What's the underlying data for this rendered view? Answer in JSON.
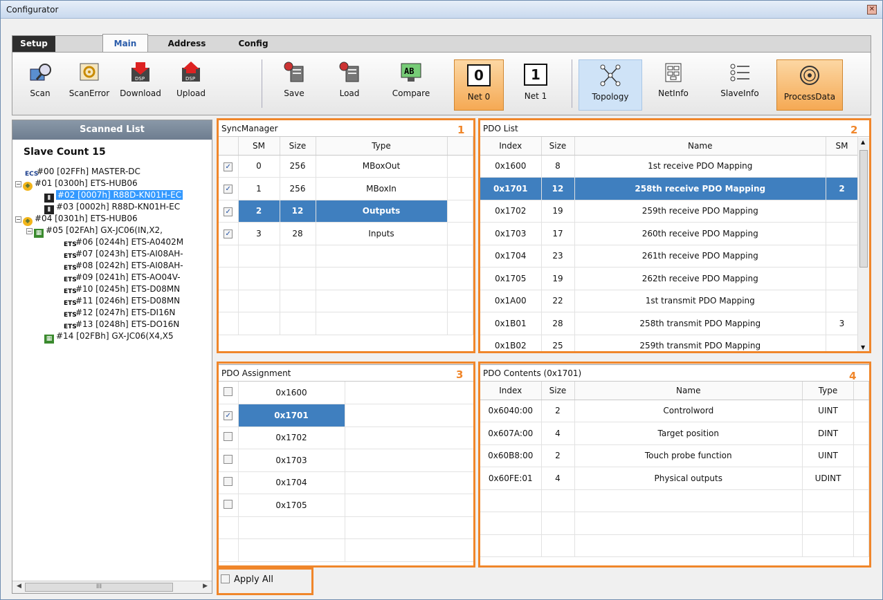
{
  "window": {
    "title": "Configurator"
  },
  "tabs": [
    {
      "label": "Setup"
    },
    {
      "label": "Main"
    },
    {
      "label": "Address"
    },
    {
      "label": "Config"
    }
  ],
  "toolbar": {
    "scan": "Scan",
    "scan_error": "ScanError",
    "download": "Download",
    "upload": "Upload",
    "save": "Save",
    "load": "Load",
    "compare": "Compare",
    "net0_number": "0",
    "net0": "Net 0",
    "net1_number": "1",
    "net1": "Net 1",
    "topology": "Topology",
    "netinfo": "NetInfo",
    "slaveinfo": "SlaveInfo",
    "processdata": "ProcessData",
    "dsp": "DSP",
    "compare_glyph": "AB"
  },
  "scanned_list": {
    "header": "Scanned List",
    "slave_count": "Slave Count  15",
    "tree": [
      {
        "text": "#00  [02FFh] MASTER-DC",
        "icon": "ECS"
      },
      {
        "text": "#01  [0300h] ETS-HUB06",
        "icon": "hub"
      },
      {
        "text": "#02  [0007h] R88D-KN01H-EC",
        "icon": "dev"
      },
      {
        "text": "#03  [0002h] R88D-KN01H-EC",
        "icon": "dev"
      },
      {
        "text": "#04  [0301h] ETS-HUB06",
        "icon": "hub"
      },
      {
        "text": "#05  [02FAh] GX-JC06(IN,X2,",
        "icon": "gx"
      },
      {
        "text": "#06  [0244h] ETS-A0402M",
        "icon": "ETS"
      },
      {
        "text": "#07  [0243h] ETS-AI08AH-",
        "icon": "ETS"
      },
      {
        "text": "#08  [0242h] ETS-AI08AH-",
        "icon": "ETS"
      },
      {
        "text": "#09  [0241h] ETS-AO04V-",
        "icon": "ETS"
      },
      {
        "text": "#10  [0245h] ETS-D08MN",
        "icon": "ETS"
      },
      {
        "text": "#11  [0246h] ETS-D08MN",
        "icon": "ETS"
      },
      {
        "text": "#12  [0247h] ETS-DI16N",
        "icon": "ETS"
      },
      {
        "text": "#13  [0248h] ETS-DO16N",
        "icon": "ETS"
      },
      {
        "text": "#14  [02FBh] GX-JC06(X4,X5",
        "icon": "gx"
      }
    ],
    "scroll_thumb": "III"
  },
  "sync_manager": {
    "title": "SyncManager",
    "marker": "1",
    "columns": [
      "SM",
      "Size",
      "Type"
    ],
    "rows": [
      {
        "checked": "✓",
        "sm": "0",
        "size": "256",
        "type": "MBoxOut"
      },
      {
        "checked": "✓",
        "sm": "1",
        "size": "256",
        "type": "MBoxIn"
      },
      {
        "checked": "✓",
        "sm": "2",
        "size": "12",
        "type": "Outputs"
      },
      {
        "checked": "✓",
        "sm": "3",
        "size": "28",
        "type": "Inputs"
      }
    ]
  },
  "pdo_list": {
    "title": "PDO List",
    "marker": "2",
    "columns": [
      "Index",
      "Size",
      "Name",
      "SM"
    ],
    "rows": [
      {
        "index": "0x1600",
        "size": "8",
        "name": "1st receive PDO Mapping",
        "sm": ""
      },
      {
        "index": "0x1701",
        "size": "12",
        "name": "258th receive PDO Mapping",
        "sm": "2"
      },
      {
        "index": "0x1702",
        "size": "19",
        "name": "259th receive PDO Mapping",
        "sm": ""
      },
      {
        "index": "0x1703",
        "size": "17",
        "name": "260th receive PDO Mapping",
        "sm": ""
      },
      {
        "index": "0x1704",
        "size": "23",
        "name": "261th receive PDO Mapping",
        "sm": ""
      },
      {
        "index": "0x1705",
        "size": "19",
        "name": "262th receive PDO Mapping",
        "sm": ""
      },
      {
        "index": "0x1A00",
        "size": "22",
        "name": "1st transmit PDO Mapping",
        "sm": ""
      },
      {
        "index": "0x1B01",
        "size": "28",
        "name": "258th transmit PDO Mapping",
        "sm": "3"
      },
      {
        "index": "0x1B02",
        "size": "25",
        "name": "259th transmit PDO Mapping",
        "sm": ""
      }
    ]
  },
  "pdo_assignment": {
    "title": "PDO Assignment",
    "marker": "3",
    "rows": [
      {
        "checked": "",
        "index": "0x1600"
      },
      {
        "checked": "✓",
        "index": "0x1701"
      },
      {
        "checked": "",
        "index": "0x1702"
      },
      {
        "checked": "",
        "index": "0x1703"
      },
      {
        "checked": "",
        "index": "0x1704"
      },
      {
        "checked": "",
        "index": "0x1705"
      }
    ]
  },
  "pdo_contents": {
    "title": "PDO Contents (0x1701)",
    "marker": "4",
    "columns": [
      "Index",
      "Size",
      "Name",
      "Type"
    ],
    "rows": [
      {
        "index": "0x6040:00",
        "size": "2",
        "name": "Controlword",
        "type": "UINT"
      },
      {
        "index": "0x607A:00",
        "size": "4",
        "name": "Target position",
        "type": "DINT"
      },
      {
        "index": "0x60B8:00",
        "size": "2",
        "name": "Touch probe function",
        "type": "UINT"
      },
      {
        "index": "0x60FE:01",
        "size": "4",
        "name": "Physical outputs",
        "type": "UDINT"
      }
    ]
  },
  "apply_all": {
    "label": "Apply All"
  },
  "colors": {
    "highlight_orange": "#f0862a",
    "selection_blue": "#3f7fbf",
    "tree_selection": "#3399ff"
  }
}
